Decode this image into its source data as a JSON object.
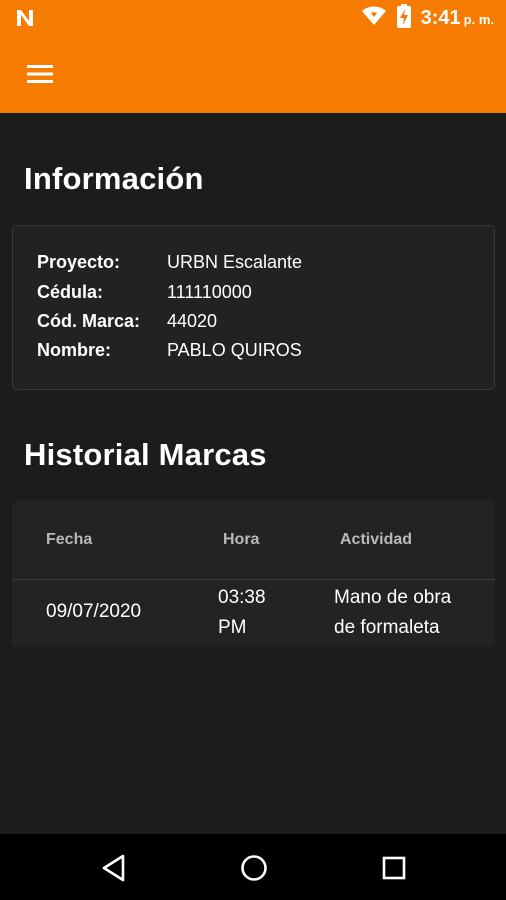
{
  "status_bar": {
    "time": "3:41",
    "time_suffix": "p. m."
  },
  "info": {
    "title": "Información",
    "rows": [
      {
        "label": "Proyecto:",
        "value": "URBN Escalante"
      },
      {
        "label": "Cédula:",
        "value": "111110000"
      },
      {
        "label": "Cód. Marca:",
        "value": "44020"
      },
      {
        "label": "Nombre:",
        "value": "PABLO QUIROS"
      }
    ]
  },
  "history": {
    "title": "Historial Marcas",
    "columns": [
      "Fecha",
      "Hora",
      "Actividad"
    ],
    "rows": [
      {
        "fecha": "09/07/2020",
        "hora_line1": "03:38",
        "hora_line2": "PM",
        "actividad_line1": "Mano de obra",
        "actividad_line2": "de formaleta"
      }
    ]
  },
  "icons": {
    "status_left": "n-logo-icon",
    "wifi": "wifi-icon",
    "battery": "battery-charging-icon",
    "menu": "hamburger-menu-icon",
    "back": "back-triangle-icon",
    "home": "home-circle-icon",
    "recents": "recents-square-icon"
  },
  "colors": {
    "appbar": "#f57c00",
    "background": "#1c1c1c",
    "card": "#222222"
  }
}
